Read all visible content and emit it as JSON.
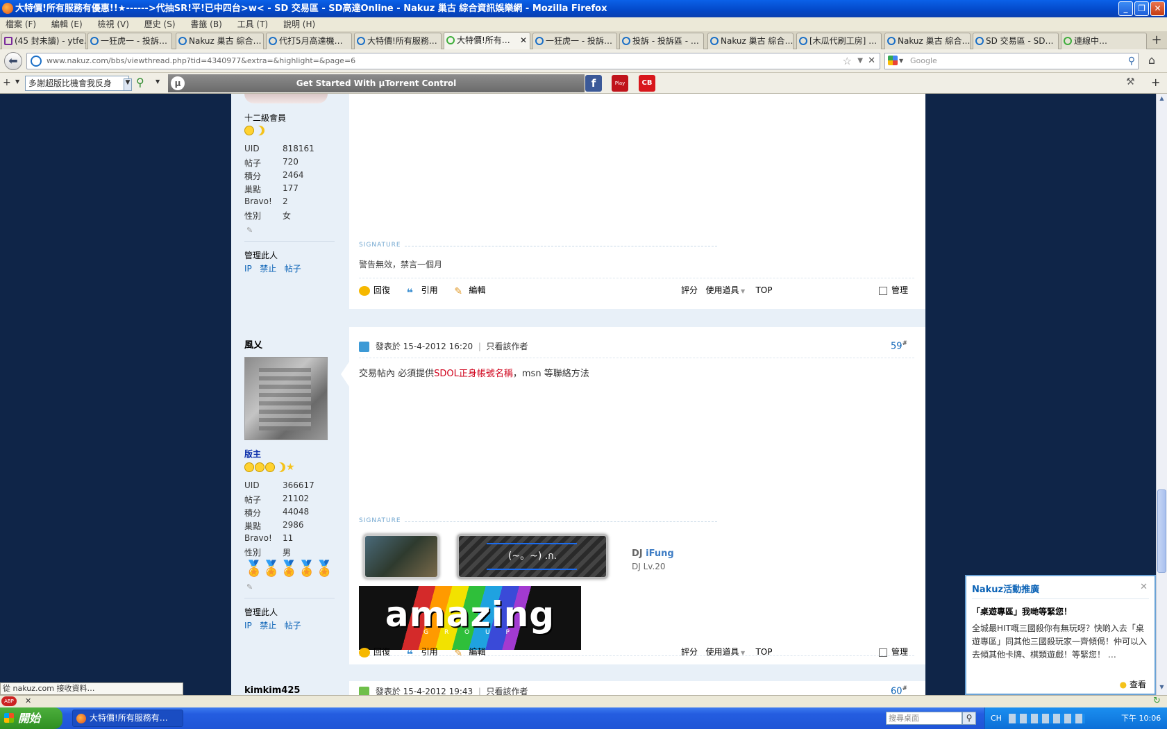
{
  "window": {
    "title": "大特價!所有服務有優惠!!★------>代抽SR!平!已中四台>w< - SD 交易區 - SD高達Online - Nakuz 巢古 綜合資訊娛樂網 - Mozilla Firefox"
  },
  "menu": [
    "檔案 (F)",
    "編輯 (E)",
    "檢視 (V)",
    "歷史 (S)",
    "書籤 (B)",
    "工具 (T)",
    "說明 (H)"
  ],
  "tabs": [
    {
      "label": "(45 封未讀) - ytfe…"
    },
    {
      "label": "一狂虎一 - 投訴…"
    },
    {
      "label": "Nakuz 巢古 綜合…"
    },
    {
      "label": "代打5月高達機…"
    },
    {
      "label": "大特價!所有服務…"
    },
    {
      "label": "大特價!所有…",
      "active": true
    },
    {
      "label": "一狂虎一 - 投訴…"
    },
    {
      "label": "投訴 - 投訴區 - …"
    },
    {
      "label": "Nakuz 巢古 綜合…"
    },
    {
      "label": "[木瓜代刷工房] …"
    },
    {
      "label": "Nakuz 巢古 綜合…"
    },
    {
      "label": "SD 交易區 - SD…"
    },
    {
      "label": "連線中…"
    }
  ],
  "nav": {
    "url": "www.nakuz.com/bbs/viewthread.php?tid=4340977&extra=&highlight=&page=6",
    "search_placeholder": "Google"
  },
  "toolbar2": {
    "dropdown_value": "多謝超版比機會我反身",
    "utorrent": "Get Started With µTorrent Control"
  },
  "post1": {
    "rank": "十二級會員",
    "stats": [
      {
        "label": "UID",
        "value": "818161"
      },
      {
        "label": "帖子",
        "value": "720"
      },
      {
        "label": "積分",
        "value": "2464"
      },
      {
        "label": "巢點",
        "value": "177"
      },
      {
        "label": "Bravo!",
        "value": "2"
      },
      {
        "label": "性別",
        "value": "女"
      }
    ],
    "manage_label": "管理此人",
    "manage_links": [
      "IP",
      "禁止",
      "帖子"
    ],
    "signature_label": "SIGNATURE",
    "signature_text": "警告無效，禁言一個月",
    "actions": [
      "回復",
      "引用",
      "編輯"
    ],
    "right_actions": [
      "評分",
      "使用道具",
      "TOP"
    ],
    "manage_checkbox": "管理"
  },
  "post2": {
    "username": "風乂",
    "rank": "版主",
    "posted_prefix": "發表於",
    "posted_time": "15-4-2012 16:20",
    "only_author": "只看該作者",
    "post_number": "59",
    "body_before": "交易帖內 必須提供",
    "body_red": "SDOL正身帳號名稱",
    "body_after": "，msn 等聯絡方法",
    "stats": [
      {
        "label": "UID",
        "value": "366617"
      },
      {
        "label": "帖子",
        "value": "21102"
      },
      {
        "label": "積分",
        "value": "44048"
      },
      {
        "label": "巢點",
        "value": "2986"
      },
      {
        "label": "Bravo!",
        "value": "11"
      },
      {
        "label": "性別",
        "value": "男"
      }
    ],
    "manage_label": "管理此人",
    "manage_links": [
      "IP",
      "禁止",
      "帖子"
    ],
    "signature_label": "SIGNATURE",
    "sig_banner_text": "(~。~) .ก.",
    "dj_prefix": "DJ",
    "dj_name": "iFung",
    "dj_level": "DJ Lv.20",
    "amazing_text": "amazing",
    "amazing_sub": "G R O U P",
    "actions": [
      "回復",
      "引用",
      "編輯"
    ],
    "right_actions": [
      "評分",
      "使用道具",
      "TOP"
    ],
    "manage_checkbox": "管理"
  },
  "post3": {
    "username": "kimkim425",
    "posted_prefix": "發表於",
    "posted_time": "15-4-2012 19:43",
    "only_author": "只看該作者",
    "post_number": "60"
  },
  "notification": {
    "title": "Nakuz活動推廣",
    "headline": "「桌遊專區」我哋等緊您！",
    "body": "全城最HIT嘅三國殺你有無玩呀？快啲入去「桌遊專區」同其他三國殺玩家一齊傾偈！仲可以入去傾其他卡牌、棋類遊戲！等緊您！ …",
    "view_label": "查看"
  },
  "status": {
    "text": "從 nakuz.com 接收資料…"
  },
  "taskbar": {
    "start": "開始",
    "item": "大特價!所有服務有…",
    "search_placeholder": "搜尋桌面",
    "time": "下午 10:06",
    "ime": "CH"
  },
  "colors": {
    "page_bg": "#0f2548",
    "link": "#0a62b6",
    "red": "#d0021b"
  }
}
